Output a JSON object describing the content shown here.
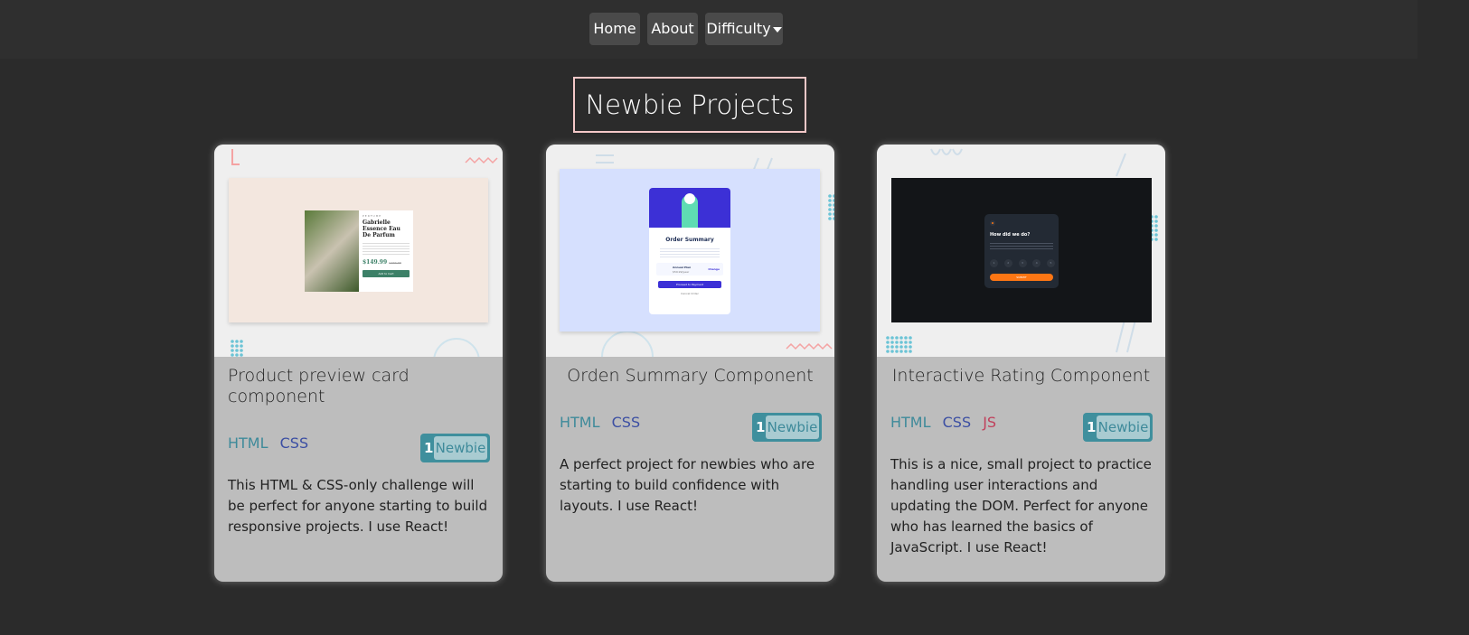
{
  "nav": {
    "home": "Home",
    "about": "About",
    "difficulty": "Difficulty"
  },
  "page": {
    "title": "Newbie Projects"
  },
  "cards": [
    {
      "title": "Product preview card component",
      "tags": [
        "HTML",
        "CSS"
      ],
      "badge_number": "1",
      "badge_label": "Newbie",
      "description": "This HTML & CSS-only challenge will be perfect for anyone starting to build responsive projects. I use React!",
      "preview": {
        "category": "PERFUME",
        "name": "Gabrielle Essence Eau De Parfum",
        "price": "$149.99",
        "old_price": "$169.99",
        "button": "Add to Cart"
      }
    },
    {
      "title": "Orden Summary Component",
      "tags": [
        "HTML",
        "CSS"
      ],
      "badge_number": "1",
      "badge_label": "Newbie",
      "description": "A perfect project for newbies who are starting to build confidence with layouts. I use React!",
      "preview": {
        "heading": "Order Summary",
        "plan": "Annual Plan",
        "plan_price": "$59.99/year",
        "change": "Change",
        "button": "Proceed to Payment",
        "cancel": "Cancel Order"
      }
    },
    {
      "title": "Interactive Rating Component",
      "tags": [
        "HTML",
        "CSS",
        "JS"
      ],
      "badge_number": "1",
      "badge_label": "Newbie",
      "description": "This is a nice, small project to practice handling user interactions and updating the DOM. Perfect for anyone who has learned the basics of JavaScript. I use React!",
      "preview": {
        "heading": "How did we do?",
        "ratings": [
          "1",
          "2",
          "3",
          "4",
          "5"
        ],
        "button": "SUBMIT"
      }
    }
  ],
  "colors": {
    "background": "#2b2b2b",
    "title_border": "#f4c8c8",
    "badge": "#3f8f9d",
    "html_tag": "#3e8a9a",
    "css_tag": "#3c4fa3",
    "js_tag": "#c0415c"
  }
}
